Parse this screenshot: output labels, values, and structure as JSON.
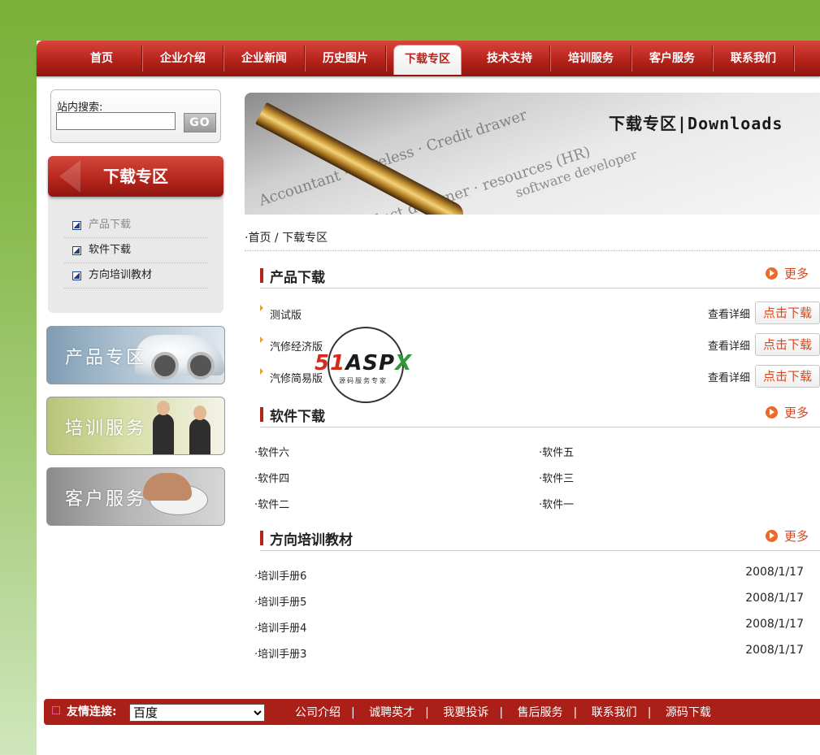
{
  "nav": {
    "items": [
      "首页",
      "企业介绍",
      "企业新闻",
      "历史图片",
      "下载专区",
      "技术支持",
      "培训服务",
      "客户服务",
      "联系我们"
    ],
    "active_index": 4
  },
  "search": {
    "label": "站内搜索:",
    "value": "",
    "button": "GO"
  },
  "sidebar": {
    "heading": "下载专区",
    "items": [
      "产品下载",
      "软件下载",
      "方向培训教材"
    ]
  },
  "promos": [
    "产品专区",
    "培训服务",
    "客户服务"
  ],
  "banner": {
    "title": "下载专区|Downloads"
  },
  "breadcrumb": {
    "home": "首页",
    "sep": " / ",
    "current": "下载专区"
  },
  "more_label": "更多",
  "products": {
    "title": "产品下载",
    "detail_label": "查看详细",
    "download_label": "点击下载",
    "items": [
      "测试版",
      "汽修经济版",
      "汽修简易版"
    ]
  },
  "software": {
    "title": "软件下载",
    "items": [
      "软件六",
      "软件五",
      "软件四",
      "软件三",
      "软件二",
      "软件一"
    ]
  },
  "training": {
    "title": "方向培训教材",
    "items": [
      {
        "name": "培训手册6",
        "date": "2008/1/17"
      },
      {
        "name": "培训手册5",
        "date": "2008/1/17"
      },
      {
        "name": "培训手册4",
        "date": "2008/1/17"
      },
      {
        "name": "培训手册3",
        "date": "2008/1/17"
      }
    ]
  },
  "footer": {
    "label": "友情连接:",
    "select_value": "百度",
    "links": [
      "公司介绍",
      "诚聘英才",
      "我要投诉",
      "售后服务",
      "联系我们",
      "源码下载"
    ]
  },
  "watermark": {
    "brand_a": "51",
    "brand_b": "ASP",
    "brand_c": "X",
    "sub": "源码服务专家"
  },
  "colors": {
    "accent": "#b3241b",
    "more": "#d8471f",
    "bg_green": "#7bb03a"
  }
}
